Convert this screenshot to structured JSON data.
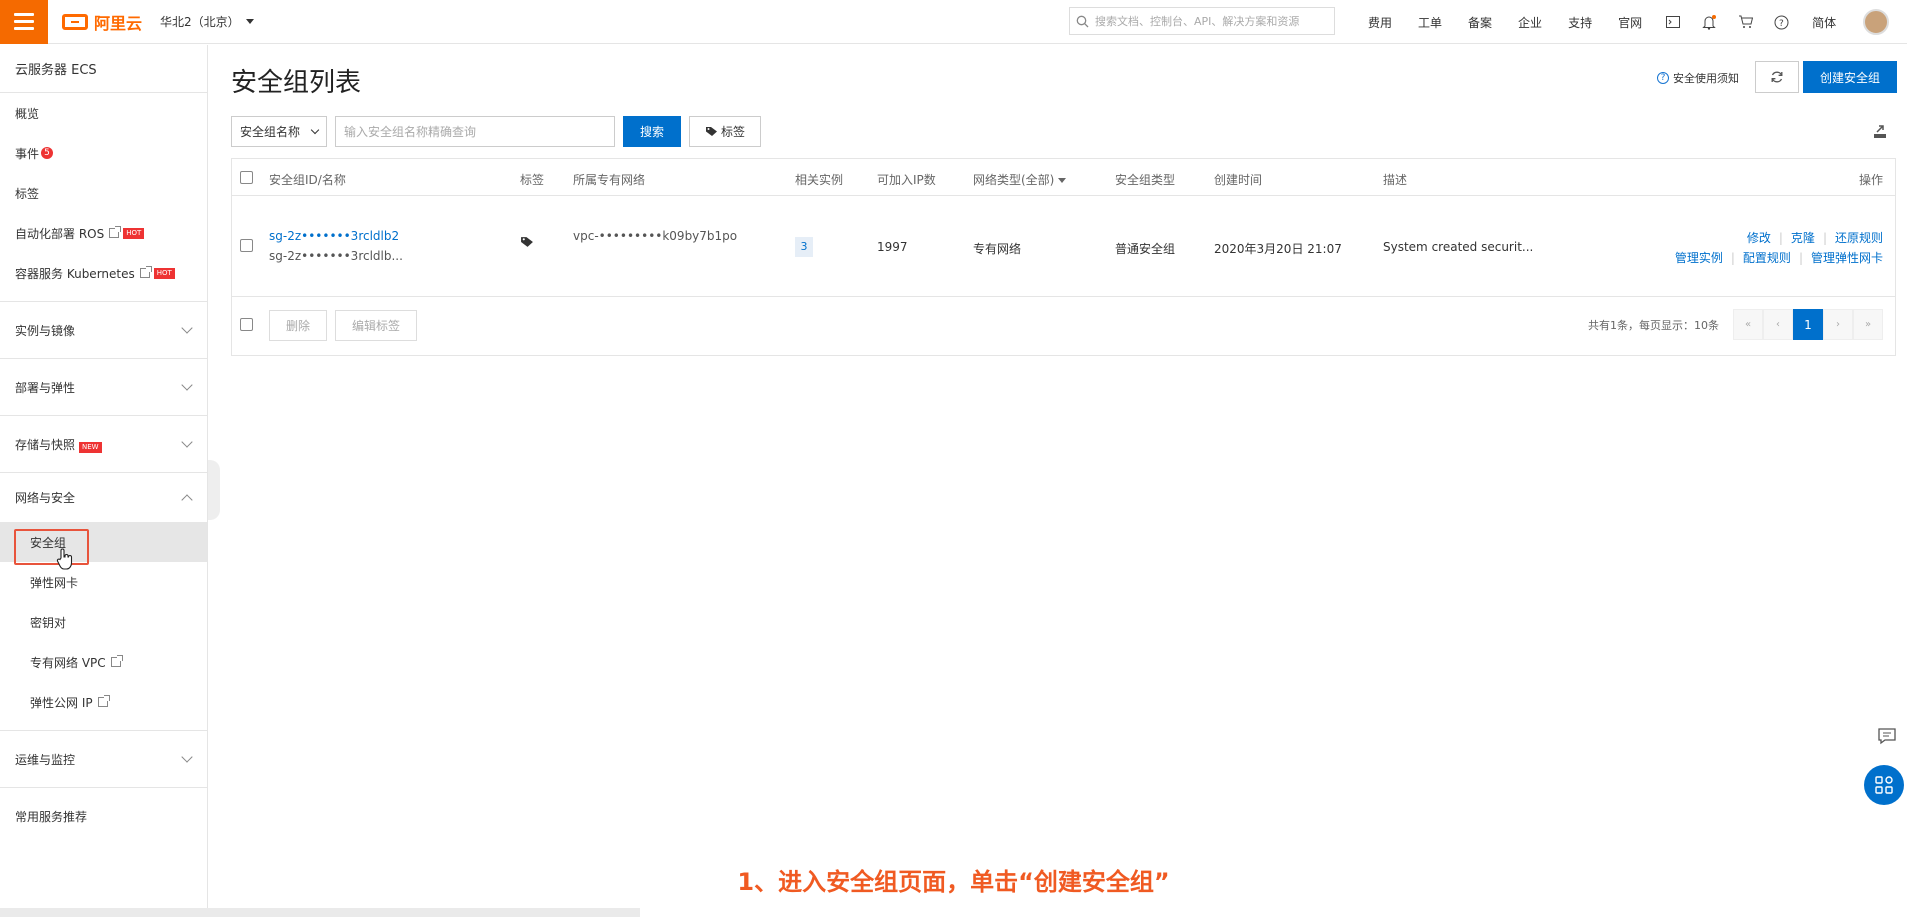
{
  "topbar": {
    "logo_text": "阿里云",
    "region": "华北2（北京）",
    "search_placeholder": "搜索文档、控制台、API、解决方案和资源",
    "nav": [
      "费用",
      "工单",
      "备案",
      "企业",
      "支持",
      "官网"
    ],
    "lang": "简体",
    "brand_color": "#ff6a00"
  },
  "sidebar": {
    "title": "云服务器 ECS",
    "items": [
      {
        "label": "概览"
      },
      {
        "label": "事件",
        "badge": "5"
      },
      {
        "label": "标签"
      },
      {
        "label": "自动化部署 ROS",
        "tag": "HOT"
      },
      {
        "label": "容器服务 Kubernetes",
        "tag": "HOT"
      }
    ],
    "groups": [
      {
        "label": "实例与镜像"
      },
      {
        "label": "部署与弹性"
      },
      {
        "label": "存储与快照",
        "tag": "NEW"
      },
      {
        "label": "网络与安全"
      }
    ],
    "network_items": [
      {
        "label": "安全组"
      },
      {
        "label": "弹性网卡"
      },
      {
        "label": "密钥对"
      },
      {
        "label": "专有网络 VPC"
      },
      {
        "label": "弹性公网 IP"
      }
    ],
    "group_ops": "运维与监控",
    "recommend": "常用服务推荐"
  },
  "page": {
    "title": "安全组列表",
    "notice": "安全使用须知",
    "create_button": "创建安全组",
    "accent_color": "#0070cc"
  },
  "filter": {
    "select_value": "安全组名称",
    "input_placeholder": "输入安全组名称精确查询",
    "search_button": "搜索",
    "tag_button": "标签"
  },
  "table": {
    "headers": [
      "安全组ID/名称",
      "标签",
      "所属专有网络",
      "相关实例",
      "可加入IP数",
      "网络类型(全部)",
      "安全组类型",
      "创建时间",
      "描述",
      "操作"
    ],
    "rows": [
      {
        "id": "sg-2z•••••••3rcldlb2",
        "name": "sg-2z•••••••3rcldlb...",
        "vpc": "vpc-•••••••••k09by7b1po",
        "instances": "3",
        "ip_count": "1997",
        "network_type": "专有网络",
        "sg_type": "普通安全组",
        "created": "2020年3月20日 21:07",
        "description": "System created securit...",
        "ops_row1": [
          "修改",
          "克隆",
          "还原规则"
        ],
        "ops_row2": [
          "管理实例",
          "配置规则",
          "管理弹性网卡"
        ]
      }
    ],
    "footer": {
      "delete_button": "删除",
      "edit_tags_button": "编辑标签",
      "total_text": "共有1条，每页显示：10条",
      "current_page": "1"
    }
  },
  "caption": "1、进入安全组页面，单击“创建安全组”"
}
